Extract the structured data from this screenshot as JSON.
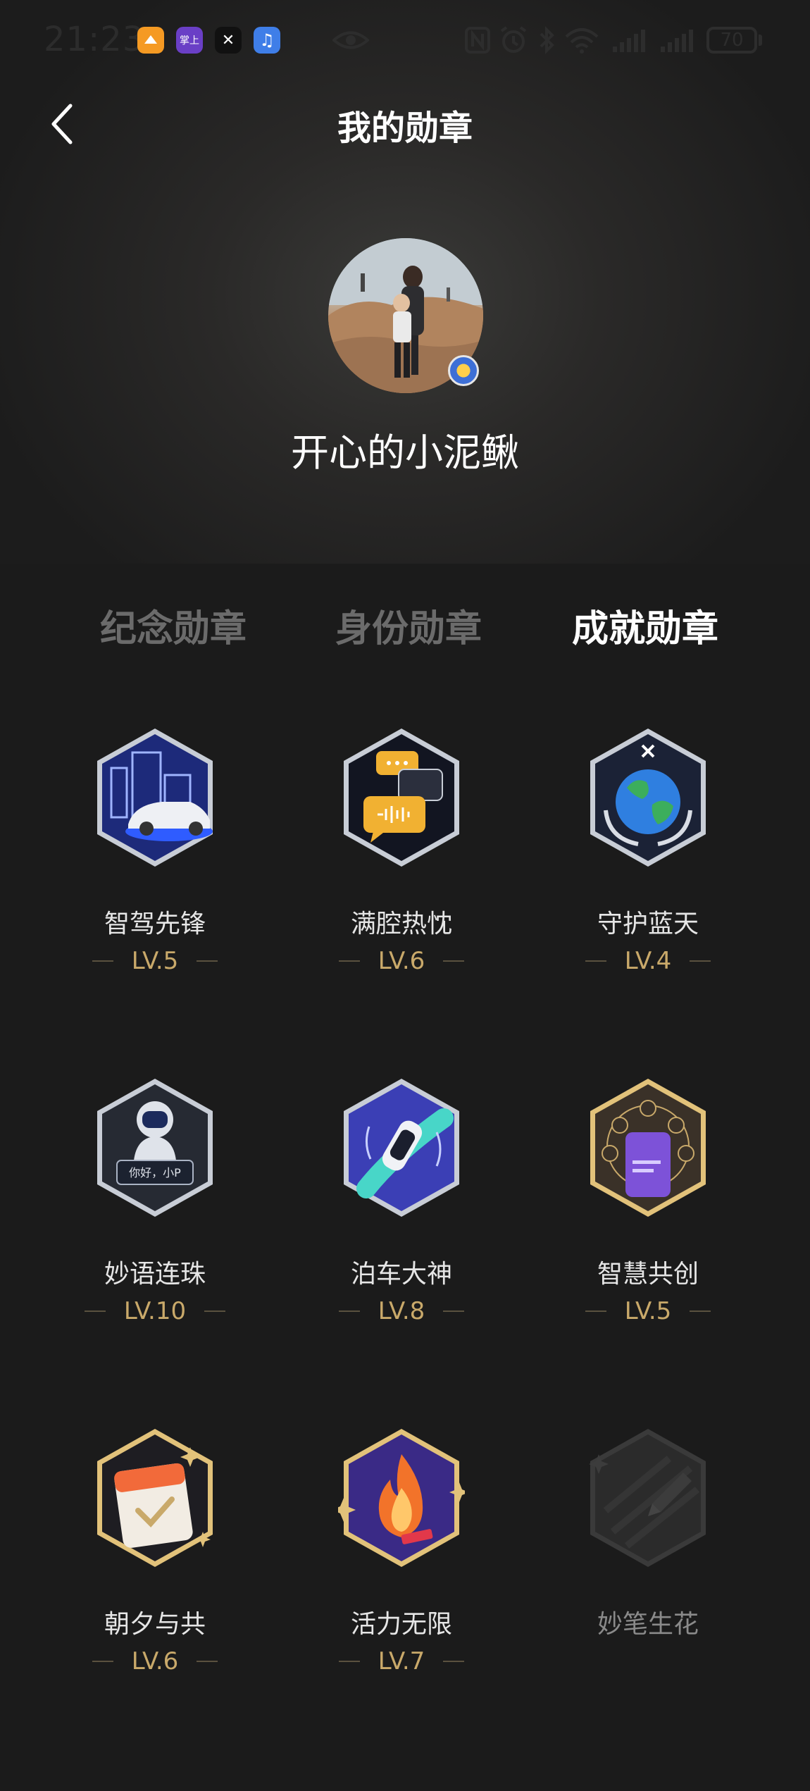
{
  "status_bar": {
    "time": "21:23",
    "apps": [
      {
        "name": "app-icon-1",
        "label": "",
        "color": "#f59a23"
      },
      {
        "name": "app-icon-2",
        "label": "掌上",
        "color": "#6a3fc6"
      },
      {
        "name": "app-icon-3",
        "label": "✕",
        "color": "#111111"
      },
      {
        "name": "app-icon-4",
        "label": "♫",
        "color": "#3f7ee8"
      }
    ],
    "battery": "70"
  },
  "header": {
    "title": "我的勋章"
  },
  "profile": {
    "username": "开心的小泥鳅"
  },
  "tabs": [
    {
      "label": "纪念勋章",
      "active": false
    },
    {
      "label": "身份勋章",
      "active": false
    },
    {
      "label": "成就勋章",
      "active": true
    }
  ],
  "badges": [
    {
      "name": "智驾先锋",
      "level": "LV.5",
      "icon": "car-city-icon"
    },
    {
      "name": "满腔热忱",
      "level": "LV.6",
      "icon": "chat-bubbles-icon"
    },
    {
      "name": "守护蓝天",
      "level": "LV.4",
      "icon": "earth-hands-icon"
    },
    {
      "name": "妙语连珠",
      "level": "LV.10",
      "icon": "robot-voice-icon"
    },
    {
      "name": "泊车大神",
      "level": "LV.8",
      "icon": "parking-car-icon"
    },
    {
      "name": "智慧共创",
      "level": "LV.5",
      "icon": "phone-apps-icon"
    },
    {
      "name": "朝夕与共",
      "level": "LV.6",
      "icon": "calendar-check-icon"
    },
    {
      "name": "活力无限",
      "level": "LV.7",
      "icon": "flame-icon"
    },
    {
      "name": "妙笔生花",
      "level": "",
      "icon": "pen-locked-icon"
    }
  ],
  "colors": {
    "background": "#1b1b1b",
    "level_gold": "#c9a96a",
    "tab_inactive": "#6b6b6b"
  }
}
